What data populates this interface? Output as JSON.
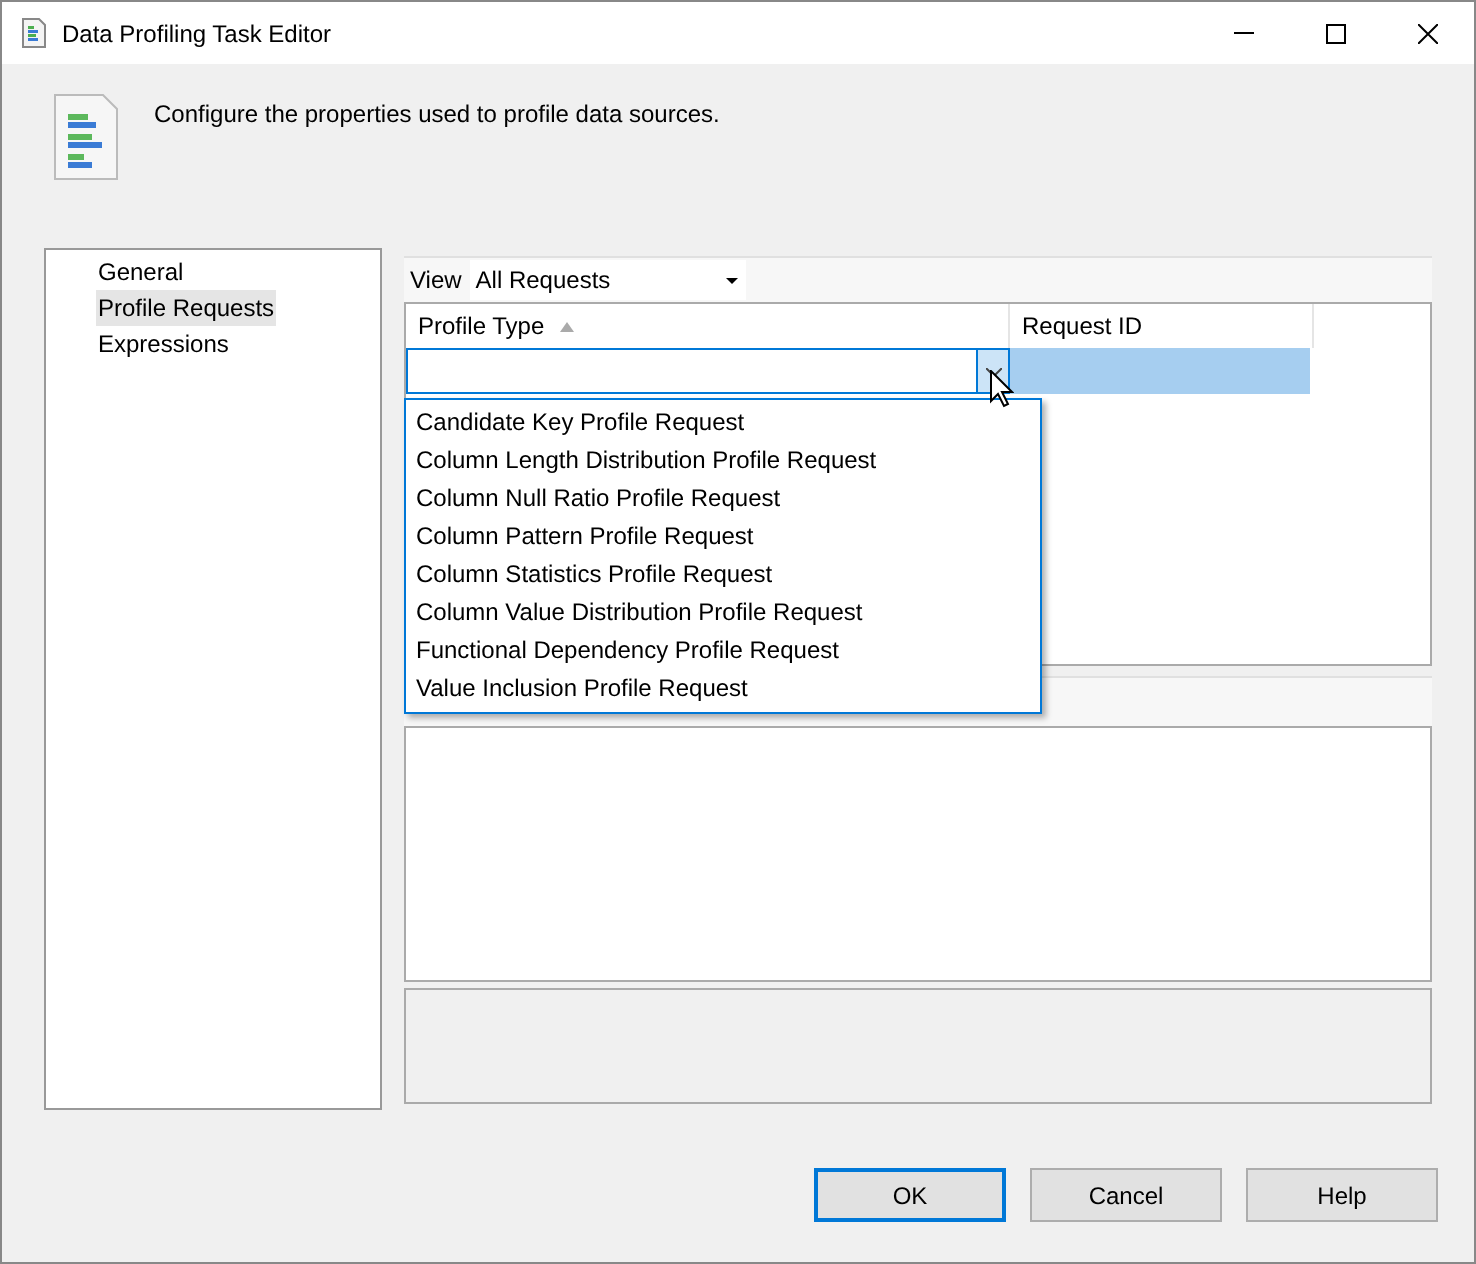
{
  "window": {
    "title": "Data Profiling Task Editor"
  },
  "header": {
    "text": "Configure the properties used to profile data sources."
  },
  "nav": {
    "items": [
      {
        "label": "General",
        "selected": false
      },
      {
        "label": "Profile Requests",
        "selected": true
      },
      {
        "label": "Expressions",
        "selected": false
      }
    ]
  },
  "view": {
    "label": "View",
    "value": "All Requests"
  },
  "grid": {
    "columns": [
      {
        "label": "Profile Type",
        "sorted": true
      },
      {
        "label": "Request ID",
        "sorted": false
      }
    ],
    "row": {
      "selected": true
    }
  },
  "dropdown": {
    "open": true,
    "options": [
      "Candidate Key Profile Request",
      "Column Length Distribution Profile Request",
      "Column Null Ratio Profile Request",
      "Column Pattern Profile Request",
      "Column Statistics Profile Request",
      "Column Value Distribution Profile Request",
      "Functional Dependency Profile Request",
      "Value Inclusion Profile Request"
    ]
  },
  "buttons": [
    {
      "label": "OK",
      "default": true
    },
    {
      "label": "Cancel",
      "default": false
    },
    {
      "label": "Help",
      "default": false
    }
  ]
}
